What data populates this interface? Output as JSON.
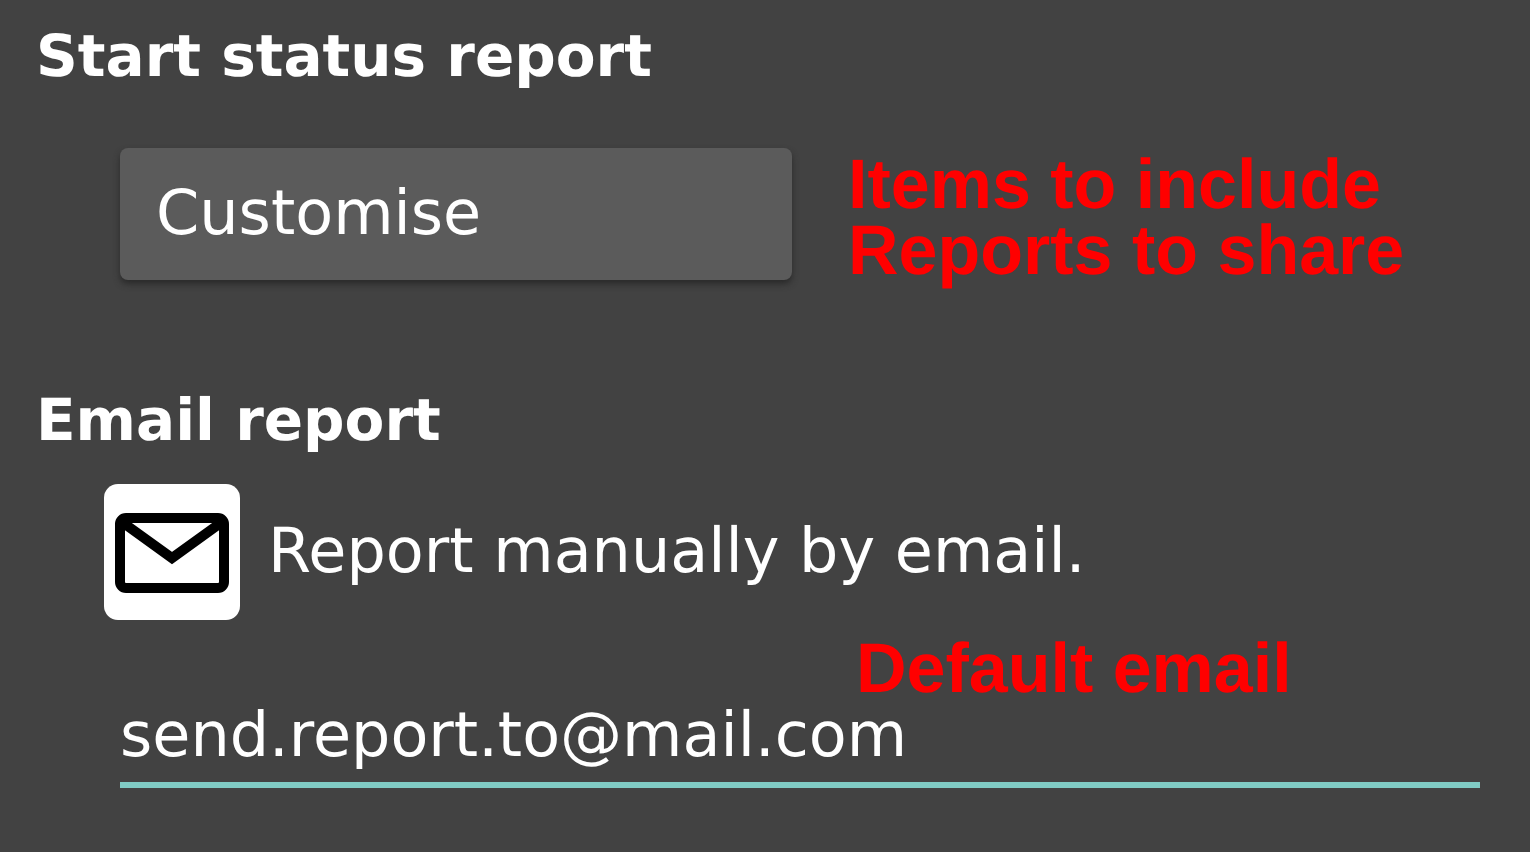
{
  "sections": [
    {
      "kind": "button",
      "title": "Start status report",
      "button": "Customise",
      "notes": [
        "Items to include",
        "Reports to share"
      ]
    },
    {
      "kind": "email",
      "title": "Email report",
      "option": "Report manually by email.",
      "notes": [
        "Default email"
      ],
      "field": {
        "value": "send.report.to@mail.com"
      }
    }
  ]
}
